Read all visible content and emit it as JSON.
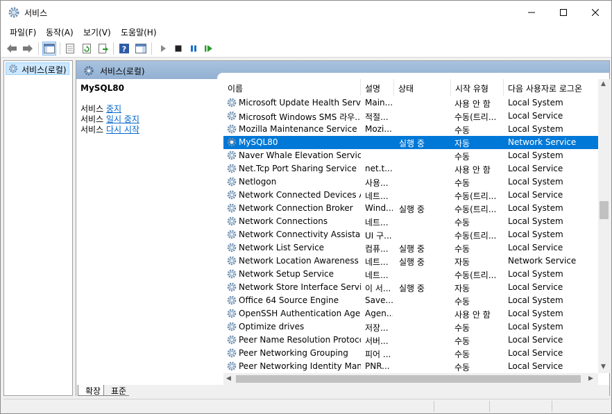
{
  "window": {
    "title": "서비스"
  },
  "menu": [
    "파일(F)",
    "동작(A)",
    "보기(V)",
    "도움말(H)"
  ],
  "toolbar": {
    "icons": [
      "back-icon",
      "forward-icon",
      "show-console-tree-icon",
      "properties-icon",
      "refresh-icon",
      "export-list-icon",
      "help-icon",
      "action-pane-icon",
      "start-service-icon",
      "stop-service-icon",
      "pause-service-icon",
      "resume-service-icon"
    ]
  },
  "tree": {
    "root_label": "서비스(로컬)"
  },
  "pane": {
    "header_title": "서비스(로컬)",
    "selected_service": "MySQL80",
    "actions": [
      {
        "prefix": "서비스 ",
        "link": "중지"
      },
      {
        "prefix": "서비스 ",
        "link": "일시 중지"
      },
      {
        "prefix": "서비스 ",
        "link": "다시 시작"
      }
    ]
  },
  "columns": [
    "이름",
    "설명",
    "상태",
    "시작 유형",
    "다음 사용자로 로그온"
  ],
  "services": [
    {
      "name": "Microsoft Update Health Service",
      "desc": "Main...",
      "status": "",
      "start": "사용 안 함",
      "logon": "Local System"
    },
    {
      "name": "Microsoft Windows SMS 라우...",
      "desc": "적절...",
      "status": "",
      "start": "수동(트리...",
      "logon": "Local Service"
    },
    {
      "name": "Mozilla Maintenance Service",
      "desc": "Mozi...",
      "status": "",
      "start": "수동",
      "logon": "Local System"
    },
    {
      "name": "MySQL80",
      "desc": "",
      "status": "실행 중",
      "start": "자동",
      "logon": "Network Service",
      "selected": true
    },
    {
      "name": "Naver Whale Elevation Service...",
      "desc": "",
      "status": "",
      "start": "수동",
      "logon": "Local System"
    },
    {
      "name": "Net.Tcp Port Sharing Service",
      "desc": "net.t...",
      "status": "",
      "start": "사용 안 함",
      "logon": "Local Service"
    },
    {
      "name": "Netlogon",
      "desc": "사용...",
      "status": "",
      "start": "수동",
      "logon": "Local System"
    },
    {
      "name": "Network Connected Devices A...",
      "desc": "네트...",
      "status": "",
      "start": "수동(트리...",
      "logon": "Local Service"
    },
    {
      "name": "Network Connection Broker",
      "desc": "Wind...",
      "status": "실행 중",
      "start": "수동(트리...",
      "logon": "Local System"
    },
    {
      "name": "Network Connections",
      "desc": "네트...",
      "status": "",
      "start": "수동",
      "logon": "Local System"
    },
    {
      "name": "Network Connectivity Assistant",
      "desc": "UI 구...",
      "status": "",
      "start": "수동(트리...",
      "logon": "Local System"
    },
    {
      "name": "Network List Service",
      "desc": "컴퓨...",
      "status": "실행 중",
      "start": "수동",
      "logon": "Local Service"
    },
    {
      "name": "Network Location Awareness",
      "desc": "네트...",
      "status": "실행 중",
      "start": "자동",
      "logon": "Network Service"
    },
    {
      "name": "Network Setup Service",
      "desc": "네트...",
      "status": "",
      "start": "수동(트리...",
      "logon": "Local System"
    },
    {
      "name": "Network Store Interface Service",
      "desc": "이 서...",
      "status": "실행 중",
      "start": "자동",
      "logon": "Local Service"
    },
    {
      "name": "Office 64 Source Engine",
      "desc": "Save...",
      "status": "",
      "start": "수동",
      "logon": "Local System"
    },
    {
      "name": "OpenSSH Authentication Agent",
      "desc": "Agen...",
      "status": "",
      "start": "사용 안 함",
      "logon": "Local System"
    },
    {
      "name": "Optimize drives",
      "desc": "저장...",
      "status": "",
      "start": "수동",
      "logon": "Local System"
    },
    {
      "name": "Peer Name Resolution Protocol",
      "desc": "서버...",
      "status": "",
      "start": "수동",
      "logon": "Local Service"
    },
    {
      "name": "Peer Networking Grouping",
      "desc": "피어 ...",
      "status": "",
      "start": "수동",
      "logon": "Local Service"
    },
    {
      "name": "Peer Networking Identity Man...",
      "desc": "PNR...",
      "status": "",
      "start": "수동",
      "logon": "Local Service"
    }
  ],
  "tabs": [
    "확장",
    "표준"
  ],
  "colors": {
    "selection": "#0078d7",
    "link": "#0066cc",
    "header_gradient": "#a8c2de"
  }
}
